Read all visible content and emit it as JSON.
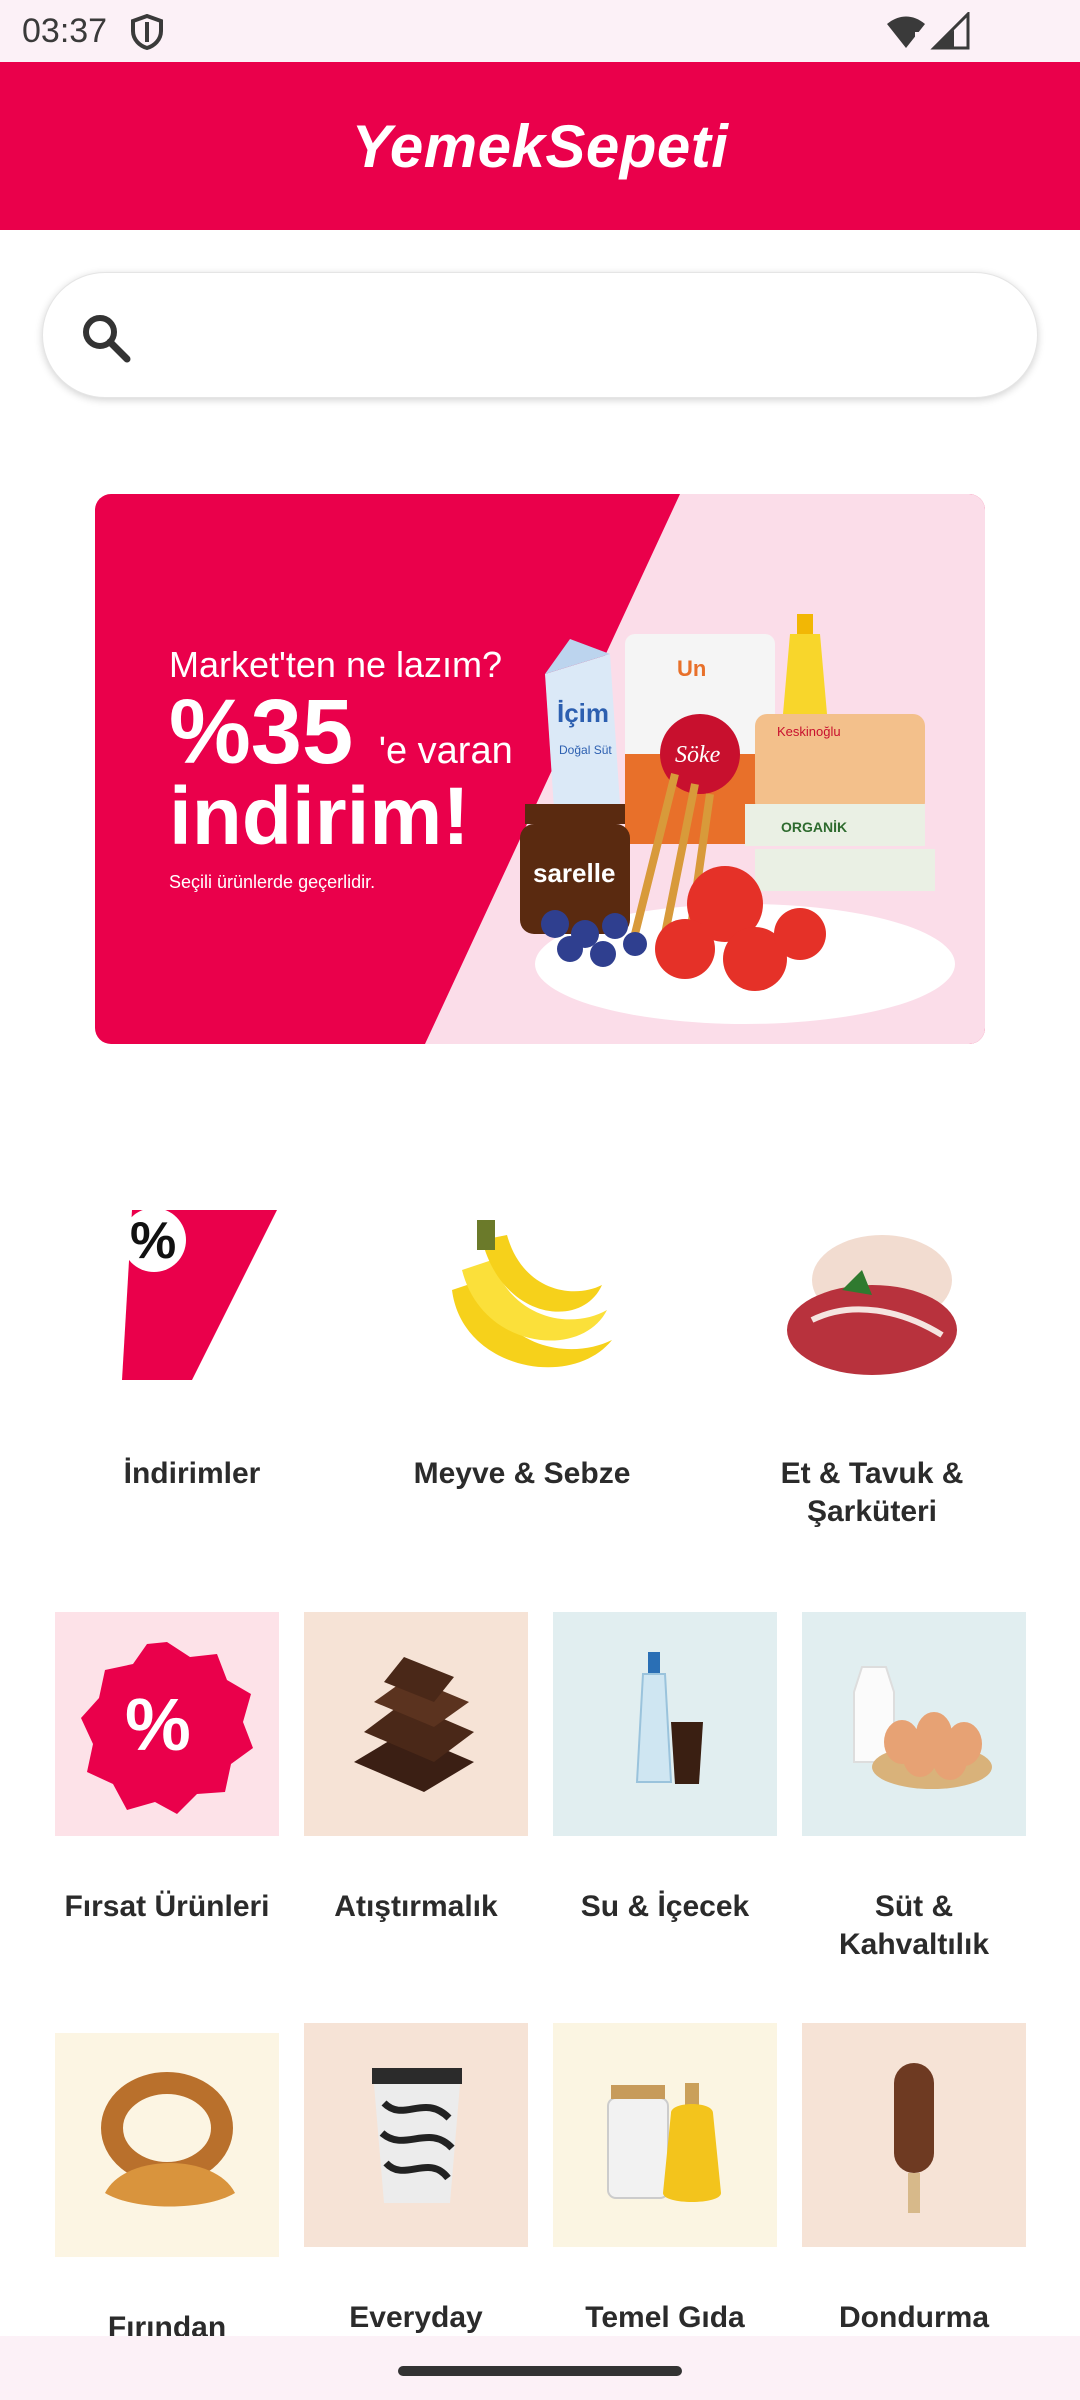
{
  "status_bar": {
    "time": "03:37",
    "icons": [
      "shield-icon",
      "wifi-icon",
      "signal-icon"
    ]
  },
  "header": {
    "brand": "YemekSepeti"
  },
  "search": {
    "placeholder": "",
    "icon": "search-icon"
  },
  "banner": {
    "line1": "Market'ten ne lazım?",
    "big": "%35",
    "big_suffix": "'e varan",
    "line3": "indirim!",
    "note": "Seçili ürünlerde geçerlidir.",
    "products": {
      "milk": "İçim",
      "milk_sub": "Doğal Süt",
      "flour": "Un",
      "flour_brand": "Söke",
      "spread": "sarelle",
      "meat_brand": "Keskinoğlu",
      "eggs": "ORGANİK"
    }
  },
  "categories_top": [
    {
      "label": "İndirimler",
      "icon": "discount-arrow-icon"
    },
    {
      "label": "Meyve & Sebze",
      "icon": "banana-icon"
    },
    {
      "label": "Et & Tavuk & Şarküteri",
      "icon": "meat-icon"
    }
  ],
  "categories_row2": [
    {
      "label": "Fırsat Ürünleri",
      "icon": "percent-badge-icon"
    },
    {
      "label": "Atıştırmalık",
      "icon": "chocolate-icon"
    },
    {
      "label": "Su & İçecek",
      "icon": "drinks-icon"
    },
    {
      "label": "Süt & Kahvaltılık",
      "icon": "milk-eggs-icon"
    }
  ],
  "categories_row3": [
    {
      "label": "Fırından",
      "icon": "simit-croissant-icon"
    },
    {
      "label": "Everyday Departure",
      "icon": "coffee-cup-icon"
    },
    {
      "label": "Temel Gıda",
      "icon": "oil-jar-icon"
    },
    {
      "label": "Dondurma",
      "icon": "ice-cream-icon"
    }
  ],
  "colors": {
    "brand": "#ea004b",
    "status_bg": "#fcf1f7"
  }
}
